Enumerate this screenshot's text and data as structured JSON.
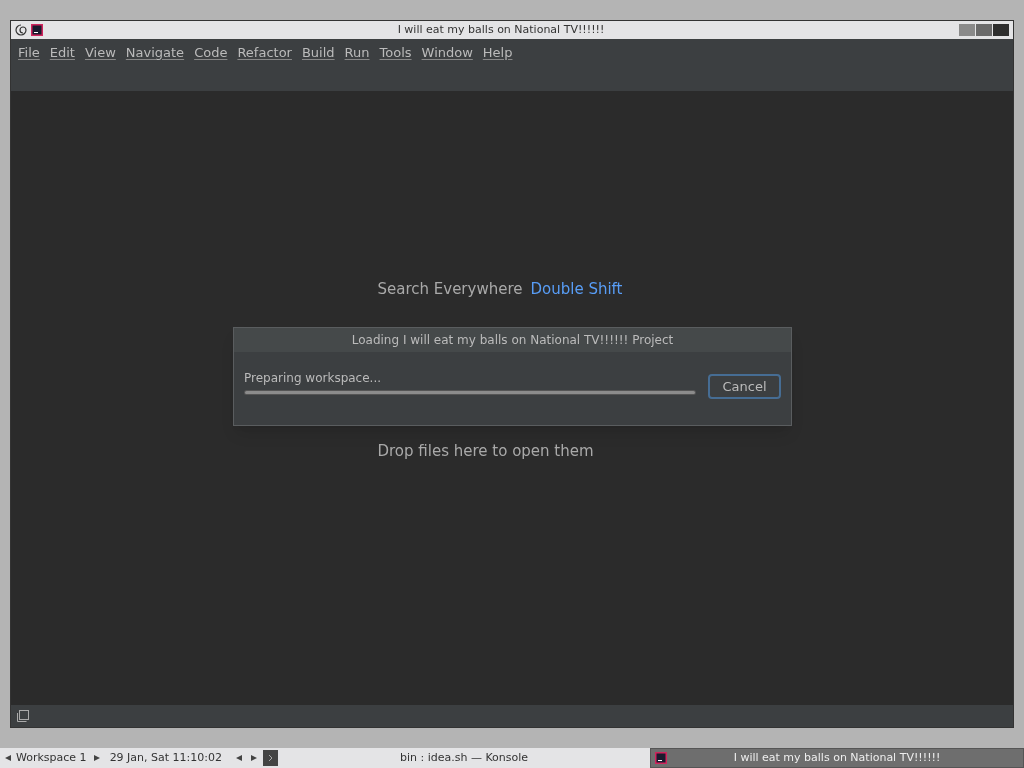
{
  "window": {
    "title": "I will eat my balls on National TV!!!!!!"
  },
  "menu": [
    "File",
    "Edit",
    "View",
    "Navigate",
    "Code",
    "Refactor",
    "Build",
    "Run",
    "Tools",
    "Window",
    "Help"
  ],
  "hints": [
    {
      "label": "Search Everywhere",
      "shortcut": "Double Shift"
    }
  ],
  "drop_text": "Drop files here to open them",
  "dialog": {
    "title": "Loading I will eat my balls on National TV!!!!!! Project",
    "message": "Preparing workspace...",
    "progress": {
      "level": 1
    },
    "button": "Cancel"
  },
  "taskbar": {
    "workspace": "Workspace 1",
    "clock": "29 Jan, Sat 11:10:02",
    "tasks": [
      {
        "title": "bin : idea.sh — Konsole",
        "selected": false
      },
      {
        "title": "I will eat my balls on National TV!!!!!!",
        "selected": true
      }
    ]
  }
}
